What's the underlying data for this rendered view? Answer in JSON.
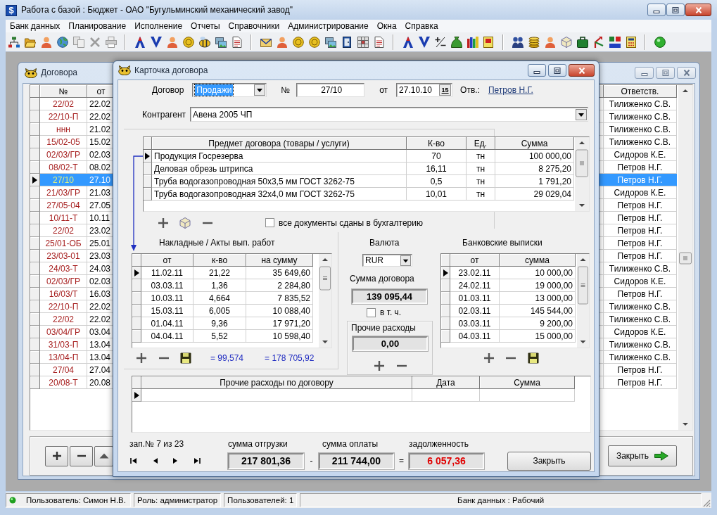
{
  "window": {
    "app_icon": "$",
    "title": "Работа с базой : Бюджет - ОАО \"Бугульминский механический завод\""
  },
  "menu": [
    "Банк данных",
    "Планирование",
    "Исполнение",
    "Отчеты",
    "Справочники",
    "Администрирование",
    "Окна",
    "Справка"
  ],
  "contracts_window": {
    "title": "Договора",
    "columns": [
      "№",
      "от",
      "Ответств."
    ],
    "rows": [
      {
        "number": "22/02",
        "date": "22.02",
        "responsible": "Тилиженко С.В.",
        "selected": false
      },
      {
        "number": "22/10-П",
        "date": "22.02",
        "responsible": "Тилиженко С.В.",
        "selected": false
      },
      {
        "number": "ннн",
        "date": "21.02",
        "responsible": "Тилиженко С.В.",
        "selected": false
      },
      {
        "number": "15/02-05",
        "date": "15.02",
        "responsible": "Тилиженко С.В.",
        "selected": false
      },
      {
        "number": "02/03/ГР",
        "date": "02.03",
        "responsible": "Сидоров К.Е.",
        "selected": false
      },
      {
        "number": "08/02-Т",
        "date": "08.02",
        "responsible": "Петров Н.Г.",
        "selected": false
      },
      {
        "number": "27/10",
        "date": "27.10",
        "responsible": "Петров Н.Г.",
        "selected": true
      },
      {
        "number": "21/03/ГР",
        "date": "21.03",
        "responsible": "Сидоров К.Е.",
        "selected": false
      },
      {
        "number": "27/05-04",
        "date": "27.05",
        "responsible": "Петров Н.Г.",
        "selected": false
      },
      {
        "number": "10/11-Т",
        "date": "10.11",
        "responsible": "Петров Н.Г.",
        "selected": false
      },
      {
        "number": "22/02",
        "date": "23.02",
        "responsible": "Петров Н.Г.",
        "selected": false
      },
      {
        "number": "25/01-ОБ",
        "date": "25.01",
        "responsible": "Петров Н.Г.",
        "selected": false
      },
      {
        "number": "23/03-01",
        "date": "23.03",
        "responsible": "Петров Н.Г.",
        "selected": false
      },
      {
        "number": "24/03-Т",
        "date": "24.03",
        "responsible": "Тилиженко С.В.",
        "selected": false
      },
      {
        "number": "02/03/ГР",
        "date": "02.03",
        "responsible": "Сидоров К.Е.",
        "selected": false
      },
      {
        "number": "16/03/Т",
        "date": "16.03",
        "responsible": "Петров Н.Г.",
        "selected": false
      },
      {
        "number": "22/10-П",
        "date": "22.02",
        "responsible": "Тилиженко С.В.",
        "selected": false
      },
      {
        "number": "22/02",
        "date": "22.02",
        "responsible": "Тилиженко С.В.",
        "selected": false
      },
      {
        "number": "03/04/ГР",
        "date": "03.04",
        "responsible": "Сидоров К.Е.",
        "selected": false
      },
      {
        "number": "31/03-П",
        "date": "13.04",
        "responsible": "Тилиженко С.В.",
        "selected": false
      },
      {
        "number": "13/04-П",
        "date": "13.04",
        "responsible": "Тилиженко С.В.",
        "selected": false
      },
      {
        "number": "27/04",
        "date": "27.04",
        "responsible": "Петров Н.Г.",
        "selected": false
      },
      {
        "number": "20/08-Т",
        "date": "20.08",
        "responsible": "Петров Н.Г.",
        "selected": false
      }
    ],
    "close_button": "Закрыть"
  },
  "contract_card": {
    "title": "Карточка договора",
    "contract_type": {
      "label": "Договор",
      "value": "Продажи",
      "focused": true
    },
    "number": {
      "label": "№",
      "value": "27/10"
    },
    "date": {
      "label": "от",
      "value": "27.10.10",
      "calendar_button": "15"
    },
    "responsible": {
      "label": "Отв.:",
      "value": "Петров Н.Г."
    },
    "counterparty": {
      "label": "Контрагент",
      "value": "Авена 2005 ЧП"
    },
    "items": {
      "columns": [
        "Предмет договора (товары / услуги)",
        "К-во",
        "Ед.",
        "Сумма"
      ],
      "rows": [
        {
          "cells": [
            "Продукция Госрезерва",
            "70",
            "тн",
            "100 000,00"
          ],
          "selected": true
        },
        {
          "cells": [
            "Деловая обрезь штрипса",
            "16,11",
            "тн",
            "8 275,20"
          ],
          "selected": false
        },
        {
          "cells": [
            "Труба водогазопроводная 50х3,5 мм ГОСТ 3262-75",
            "0,5",
            "тн",
            "1 791,20"
          ],
          "selected": false
        },
        {
          "cells": [
            "Труба водогазопроводная 32х4,0 мм ГОСТ 3262-75",
            "10,01",
            "тн",
            "29 029,04"
          ],
          "selected": false
        }
      ]
    },
    "all_documents_submitted": {
      "label": "все документы сданы в бухгалтерию",
      "checked": false
    },
    "invoices": {
      "title": "Накладные / Акты вып. работ",
      "columns": [
        "от",
        "к-во",
        "на сумму"
      ],
      "rows": [
        {
          "cells": [
            "11.02.11",
            "21,22",
            "35 649,60"
          ],
          "selected": true
        },
        {
          "cells": [
            "03.03.11",
            "1,36",
            "2 284,80"
          ],
          "selected": false
        },
        {
          "cells": [
            "10.03.11",
            "4,664",
            "7 835,52"
          ],
          "selected": false
        },
        {
          "cells": [
            "15.03.11",
            "6,005",
            "10 088,40"
          ],
          "selected": false
        },
        {
          "cells": [
            "01.04.11",
            "9,36",
            "17 971,20"
          ],
          "selected": false
        },
        {
          "cells": [
            "04.04.11",
            "5,52",
            "10 598,40"
          ],
          "selected": false
        }
      ],
      "total_quantity": "= 99,574",
      "total_sum": "= 178 705,92"
    },
    "currency": {
      "label": "Валюта",
      "value": "RUR"
    },
    "contract_sum": {
      "label": "Сумма договора",
      "value": "139 095,44"
    },
    "including_vat": {
      "label": "в т. ч.",
      "checked": false
    },
    "other_expenses": {
      "label": "Прочие расходы",
      "value": "0,00"
    },
    "bank_statements": {
      "title": "Банковские выписки",
      "columns": [
        "от",
        "сумма"
      ],
      "rows": [
        {
          "cells": [
            "23.02.11",
            "10 000,00"
          ],
          "selected": true
        },
        {
          "cells": [
            "24.02.11",
            "19 000,00"
          ],
          "selected": false
        },
        {
          "cells": [
            "01.03.11",
            "13 000,00"
          ],
          "selected": false
        },
        {
          "cells": [
            "02.03.11",
            "145 544,00"
          ],
          "selected": false
        },
        {
          "cells": [
            "03.03.11",
            "9 200,00"
          ],
          "selected": false
        },
        {
          "cells": [
            "04.03.11",
            "15 000,00"
          ],
          "selected": false
        }
      ]
    },
    "expenses": {
      "columns": [
        "Прочие расходы по договору",
        "Дата",
        "Сумма"
      ],
      "rows": [
        {
          "selected": true
        }
      ]
    },
    "record_position": "зап.№ 7 из 23",
    "totals": {
      "shipment_label": "сумма отгрузки",
      "shipment": "217 801,36",
      "minus": "-",
      "payment_label": "сумма оплаты",
      "payment": "211 744,00",
      "equals": "=",
      "debt_label": "задолженность",
      "debt": "6 057,36"
    },
    "close_button": "Закрыть"
  },
  "status_bar": {
    "user": "Пользователь: Симон Н.В.",
    "role": "Роль: администратор",
    "users": "Пользователей: 1",
    "database": "Банк данных : Рабочий"
  }
}
